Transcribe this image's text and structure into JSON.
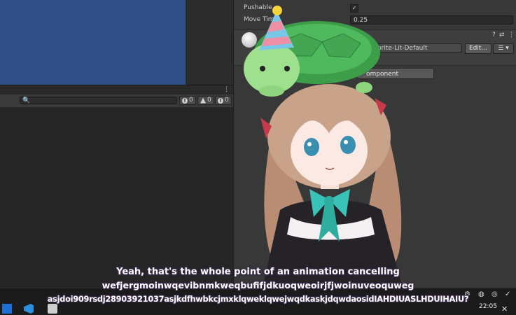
{
  "inspector": {
    "pushable_label": "Pushable",
    "pushable_checked": "✓",
    "move_time_label": "Move Time",
    "move_time_value": "0.25",
    "shader_value": "e/2D/Sprite-Lit-Default",
    "edit_label": "Edit...",
    "list_label": "☰ ▾",
    "add_component_label": "omponent",
    "help_icon": "?",
    "settings_icon": "⇄",
    "more_icon": "⋮"
  },
  "console": {
    "search_placeholder": "🔍",
    "errors_count": "0",
    "warnings_count": "0",
    "logs_count": "0",
    "menu_icon": "⋮"
  },
  "taskbar": {
    "time": "22:05",
    "close_glyph": "✕"
  },
  "subtitles": {
    "line1": "Yeah, that's the whole point of an animation cancelling",
    "line2": "wefjergmoinwqevibnmkweqbufifjdkuoqweoirjfjwoinuveoquweg",
    "line3": "asjdoi909rsdj28903921037asjkdfhwbkcjmxklqweklqwejwqdkaskjdqwdaosidIAHDIUASLHDUIHAIU?"
  },
  "colors": {
    "scene_blue": "#304f86",
    "turtle_green": "#4fb95e",
    "shell_green": "#3d9e4a",
    "hair": "#c9a28a",
    "ribbon_teal": "#39c3b8",
    "bow_red": "#c83a4a"
  }
}
